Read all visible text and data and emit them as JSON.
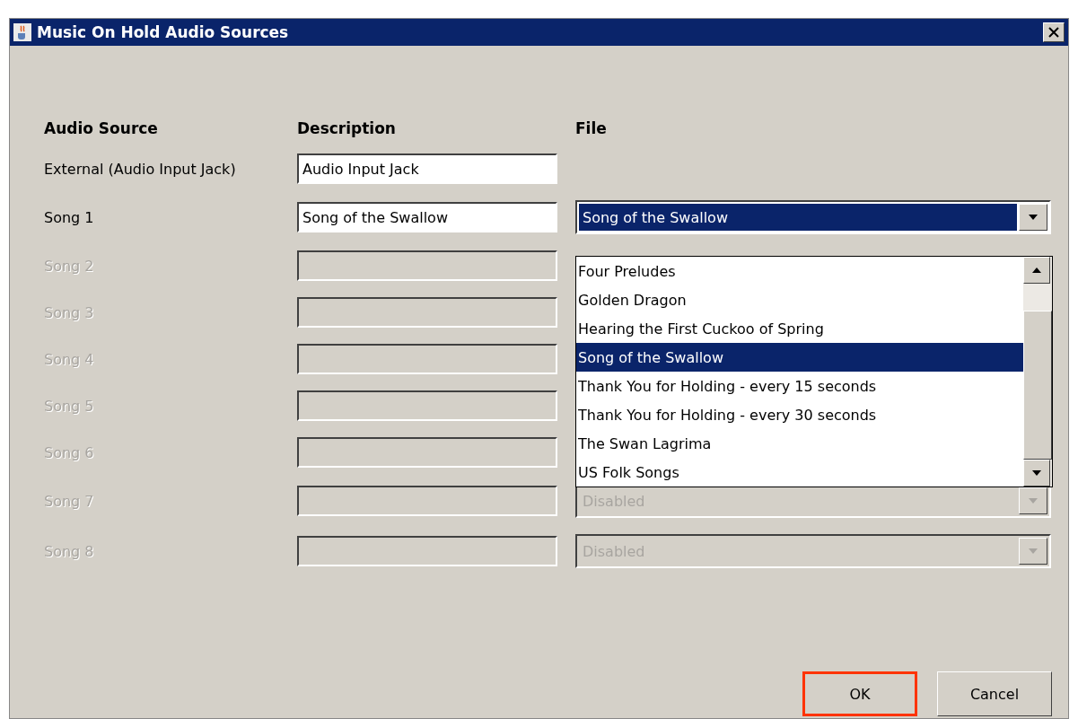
{
  "window": {
    "title": "Music On Hold Audio Sources"
  },
  "columns": [
    "Audio Source",
    "Description",
    "File"
  ],
  "rows": [
    {
      "label": "External (Audio Input Jack)",
      "disabled": false,
      "description": "Audio Input Jack"
    },
    {
      "label": "Song 1",
      "disabled": false,
      "description": "Song of the Swallow",
      "file": {
        "value": "Song of the Swallow",
        "disabled": false,
        "expanded": true
      }
    },
    {
      "label": "Song 2",
      "disabled": true,
      "description": ""
    },
    {
      "label": "Song 3",
      "disabled": true,
      "description": ""
    },
    {
      "label": "Song 4",
      "disabled": true,
      "description": ""
    },
    {
      "label": "Song 5",
      "disabled": true,
      "description": ""
    },
    {
      "label": "Song 6",
      "disabled": true,
      "description": ""
    },
    {
      "label": "Song 7",
      "disabled": true,
      "description": "",
      "file": {
        "value": "Disabled",
        "disabled": true,
        "expanded": false
      }
    },
    {
      "label": "Song 8",
      "disabled": true,
      "description": "",
      "file": {
        "value": "Disabled",
        "disabled": true,
        "expanded": false
      }
    }
  ],
  "dropdown_options": [
    {
      "label": "Four Preludes",
      "selected": false
    },
    {
      "label": "Golden Dragon",
      "selected": false
    },
    {
      "label": "Hearing the First Cuckoo of Spring",
      "selected": false
    },
    {
      "label": "Song of the Swallow",
      "selected": true
    },
    {
      "label": "Thank You for Holding - every 15 seconds",
      "selected": false
    },
    {
      "label": "Thank You for Holding - every 30 seconds",
      "selected": false
    },
    {
      "label": "The Swan Lagrima",
      "selected": false
    },
    {
      "label": "US Folk Songs",
      "selected": false
    }
  ],
  "buttons": [
    {
      "label": "OK",
      "highlighted": true
    },
    {
      "label": "Cancel",
      "highlighted": false
    }
  ]
}
